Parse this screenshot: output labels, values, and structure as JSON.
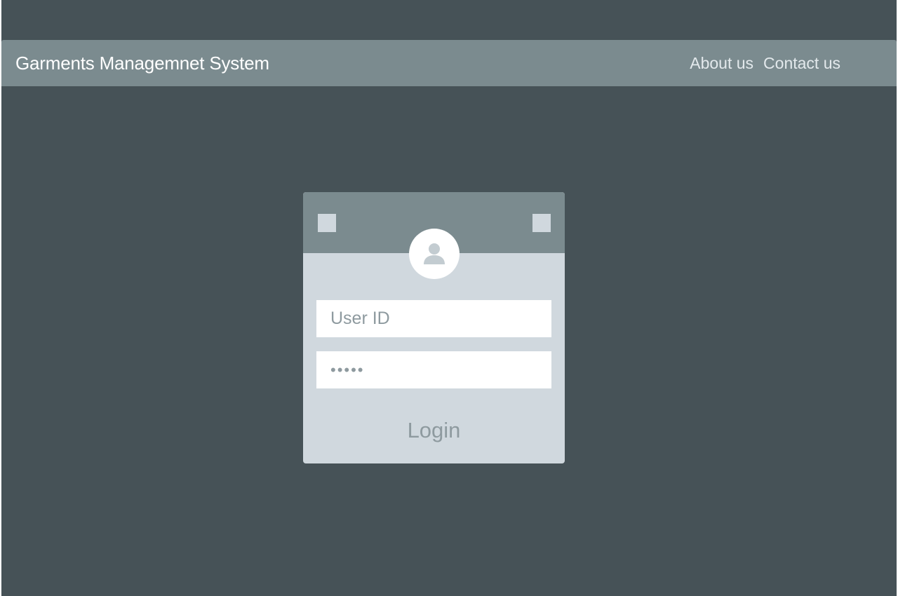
{
  "header": {
    "brand": "Garments Managemnet System",
    "links": [
      {
        "label": "About us"
      },
      {
        "label": "Contact us"
      }
    ]
  },
  "login": {
    "user_id": {
      "placeholder": "User ID",
      "value": ""
    },
    "password": {
      "value": "•••••"
    },
    "button_label": "Login",
    "avatar_icon": "user-icon"
  },
  "colors": {
    "background": "#465257",
    "navbar": "#7b8b8f",
    "card": "#d0d8de",
    "input": "#ffffff",
    "muted_text": "#8e9a9f"
  }
}
